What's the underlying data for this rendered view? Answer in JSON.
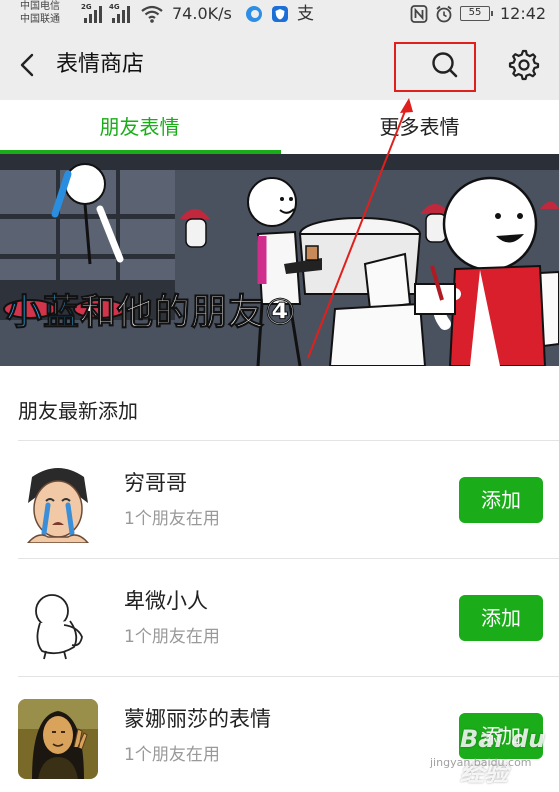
{
  "status_bar": {
    "carrier_1": "中国电信",
    "carrier_2": "中国联通",
    "sig_1_tag": "2G",
    "sig_2_tag": "4G",
    "network_speed": "74.0K/s",
    "pay_icon_text": "支",
    "battery_level": "55",
    "time": "12:42",
    "icons": [
      "signal-icon",
      "wifi-icon",
      "browser-icon",
      "shield-icon",
      "alipay-icon",
      "nfc-icon",
      "alarm-icon",
      "battery-icon"
    ]
  },
  "header": {
    "title": "表情商店",
    "icons": [
      "back-arrow-icon",
      "search-icon",
      "gear-icon"
    ]
  },
  "tabs": [
    {
      "label": "朋友表情",
      "active": true
    },
    {
      "label": "更多表情",
      "active": false
    }
  ],
  "banner": {
    "title_highlight": "小蓝",
    "title_rest": "和他的朋友④"
  },
  "section": {
    "title": "朋友最新添加"
  },
  "stickers": [
    {
      "name": "穷哥哥",
      "subtitle": "1个朋友在用",
      "button": "添加",
      "avatar_icon": "crying-man-icon"
    },
    {
      "name": "卑微小人",
      "subtitle": "1个朋友在用",
      "button": "添加",
      "avatar_icon": "bowing-figure-icon"
    },
    {
      "name": "蒙娜丽莎的表情",
      "subtitle": "1个朋友在用",
      "button": "添加",
      "avatar_icon": "mona-lisa-icon"
    }
  ],
  "watermark": {
    "text": "Bai du 经验",
    "url": "jingyan.baidu.com"
  },
  "colors": {
    "accent_green": "#1aad19",
    "annotation_red": "#e0201c",
    "header_bg": "#ededed",
    "banner_blue_text": "#2aa6e8"
  }
}
